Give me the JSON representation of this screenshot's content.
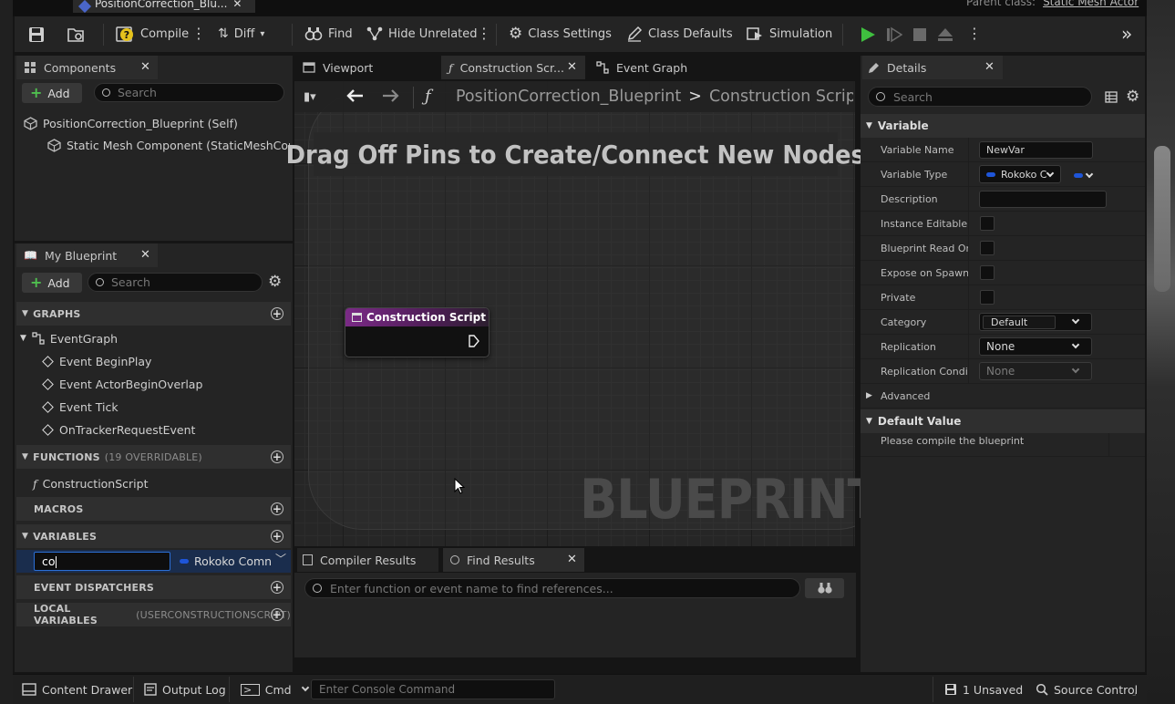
{
  "window": {
    "asset_tab": "PositionCorrection_Blu...",
    "parent_class_label": "Parent class:",
    "parent_class_value": "Static Mesh Actor"
  },
  "toolbar": {
    "compile": "Compile",
    "diff": "Diff",
    "find": "Find",
    "hide_unrelated": "Hide Unrelated",
    "class_settings": "Class Settings",
    "class_defaults": "Class Defaults",
    "simulation": "Simulation"
  },
  "components": {
    "tab": "Components",
    "add": "Add",
    "search_placeholder": "Search",
    "items": [
      "PositionCorrection_Blueprint (Self)",
      "Static Mesh Component (StaticMeshComp"
    ]
  },
  "my_blueprint": {
    "tab": "My Blueprint",
    "add": "Add",
    "search_placeholder": "Search",
    "graphs_header": "GRAPHS",
    "event_graph": "EventGraph",
    "events": [
      "Event BeginPlay",
      "Event ActorBeginOverlap",
      "Event Tick",
      "OnTrackerRequestEvent"
    ],
    "functions_header": "FUNCTIONS",
    "functions_note": "(19 OVERRIDABLE)",
    "construction_script": "ConstructionScript",
    "macros_header": "MACROS",
    "variables_header": "VARIABLES",
    "variable_name_edit": "co",
    "variable_type": "Rokoko Comn",
    "dispatchers_header": "EVENT DISPATCHERS",
    "local_vars_header": "LOCAL VARIABLES",
    "local_vars_note": "(USERCONSTRUCTIONSCRIPT)"
  },
  "graph_tabs": {
    "viewport": "Viewport",
    "construction": "Construction Scr...",
    "event_graph": "Event Graph"
  },
  "graph": {
    "breadcrumb_root": "PositionCorrection_Blueprint",
    "breadcrumb_sep": ">",
    "breadcrumb_current": "Construction Scrip",
    "hint": "Drag Off Pins to Create/Connect New Nodes",
    "node_title": "Construction Script",
    "watermark": "BLUEPRINT"
  },
  "results": {
    "compiler_tab": "Compiler Results",
    "find_tab": "Find Results",
    "find_placeholder": "Enter function or event name to find references..."
  },
  "details": {
    "tab": "Details",
    "search_placeholder": "Search",
    "variable_section": "Variable",
    "rows": {
      "variable_name": "Variable Name",
      "variable_type": "Variable Type",
      "description": "Description",
      "instance_editable": "Instance Editable",
      "blueprint_read_only": "Blueprint Read Only",
      "expose_on_spawn": "Expose on Spawn",
      "private": "Private",
      "category": "Category",
      "replication": "Replication",
      "replication_condition": "Replication Conditi"
    },
    "values": {
      "variable_name": "NewVar",
      "variable_type": "Rokoko C",
      "category": "Default",
      "replication": "None",
      "replication_condition": "None"
    },
    "advanced": "Advanced",
    "default_value_section": "Default Value",
    "compile_msg": "Please compile the blueprint"
  },
  "statusbar": {
    "content_drawer": "Content Drawer",
    "output_log": "Output Log",
    "cmd": "Cmd",
    "console_placeholder": "Enter Console Command",
    "unsaved": "1 Unsaved",
    "source_control": "Source Control"
  },
  "colors": {
    "accent_blue": "#2b6fd6",
    "play_green": "#3fbf3f",
    "function_purple": "#7a2a86",
    "variable_blue": "#1e55d8"
  }
}
